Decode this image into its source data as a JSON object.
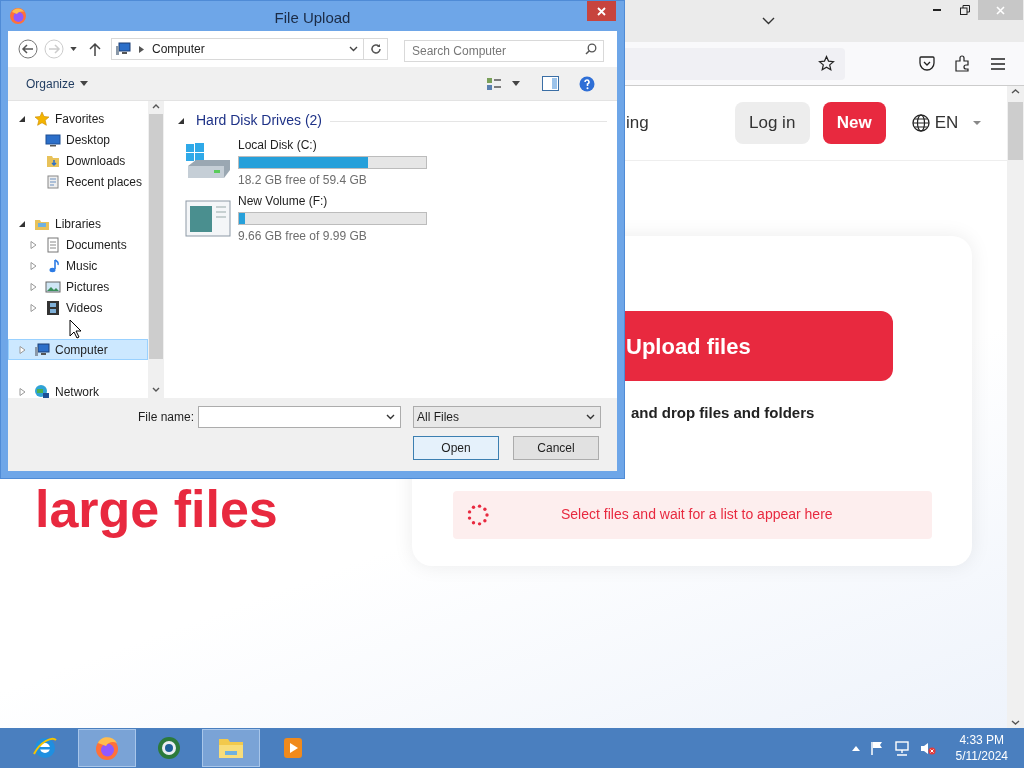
{
  "page": {
    "header": {
      "partial_link": "ing",
      "login": "Log in",
      "new": "New",
      "language": "EN"
    },
    "hero": {
      "heading": "large files"
    },
    "upload": {
      "button": "Upload files",
      "hint": "and drop files and folders",
      "status": "Select files and wait for a list to appear here"
    }
  },
  "dialog": {
    "title": "File Upload",
    "address": {
      "location": "Computer"
    },
    "search": {
      "placeholder": "Search Computer"
    },
    "toolbar": {
      "organize": "Organize"
    },
    "nav": [
      {
        "label": "Favorites",
        "kind": "favorites",
        "expanded": true,
        "selected": false,
        "children": [
          {
            "label": "Desktop",
            "kind": "desktop",
            "selected": false
          },
          {
            "label": "Downloads",
            "kind": "downloads",
            "selected": false
          },
          {
            "label": "Recent places",
            "kind": "recent",
            "selected": false
          }
        ]
      },
      {
        "label": "Libraries",
        "kind": "libraries",
        "expanded": true,
        "selected": false,
        "children": [
          {
            "label": "Documents",
            "kind": "documents",
            "expanded": false,
            "selected": false
          },
          {
            "label": "Music",
            "kind": "music",
            "expanded": false,
            "selected": false
          },
          {
            "label": "Pictures",
            "kind": "pictures",
            "expanded": false,
            "selected": false
          },
          {
            "label": "Videos",
            "kind": "videos",
            "expanded": false,
            "selected": false
          }
        ]
      },
      {
        "label": "Computer",
        "kind": "computer",
        "expanded": false,
        "selected": true
      },
      {
        "label": "Network",
        "kind": "network",
        "expanded": false,
        "selected": false
      }
    ],
    "section": {
      "title": "Hard Disk Drives (2)",
      "expanded": true,
      "drives": [
        {
          "kind": "system",
          "name": "Local Disk (C:)",
          "level": 0.69,
          "free": "18.2 GB free of 59.4 GB"
        },
        {
          "kind": "volume",
          "name": "New Volume (F:)",
          "level": 0.03,
          "free": "9.66 GB free of 9.99 GB"
        }
      ]
    },
    "footer": {
      "file_name_label": "File name:",
      "filter": "All Files",
      "buttons": [
        {
          "label": "Open",
          "default": true
        },
        {
          "label": "Cancel",
          "default": false
        }
      ]
    }
  },
  "taskbar": {
    "apps": [
      {
        "kind": "ie",
        "selected": false
      },
      {
        "kind": "firefox",
        "selected": true
      },
      {
        "kind": "globe",
        "selected": false
      },
      {
        "kind": "explorer",
        "selected": true
      },
      {
        "kind": "player",
        "selected": false
      }
    ],
    "time": "4:33 PM",
    "date": "5/11/2024"
  }
}
